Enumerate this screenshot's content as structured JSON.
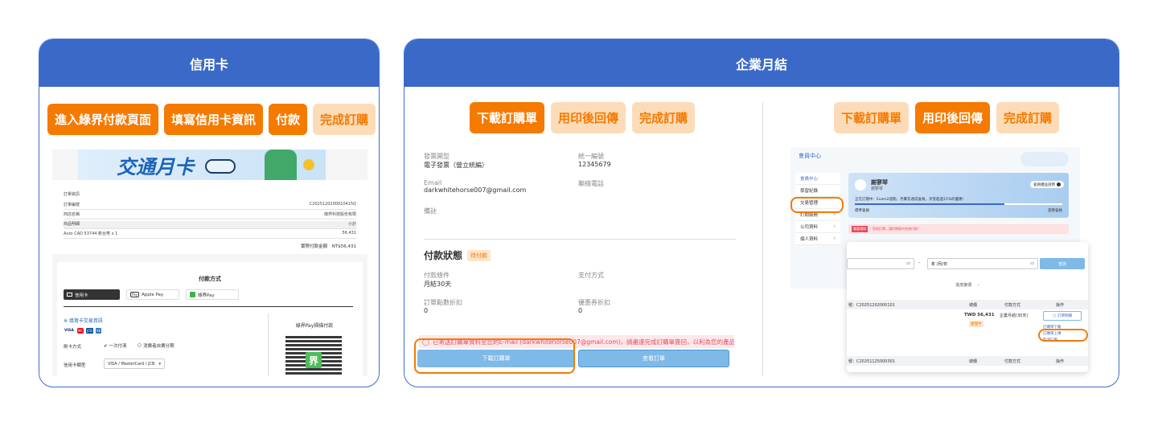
{
  "panels": {
    "credit": {
      "title": "信用卡",
      "steps": [
        "進入綠界付款頁面",
        "填寫信用卡資訊",
        "付款",
        "完成訂購"
      ],
      "screenshot": {
        "banner_text": "交通月卡",
        "order_rows": [
          {
            "label": "訂單資訊",
            "value": ""
          },
          {
            "label": "訂單編號",
            "value": "C2025120200010415Q"
          },
          {
            "label": "商店名稱",
            "value": "綠界科技股份有限"
          },
          {
            "label": "商品明細",
            "value": "小計"
          },
          {
            "label": "Auto CAD 53744 新台幣 x 1",
            "value": "56,431"
          }
        ],
        "total_label": "實際付款金額",
        "total_value": "NT$56,431",
        "payment_title": "付款方式",
        "methods": [
          "信用卡",
          "Apple Pay",
          "綠界Pay"
        ],
        "pay_logo_text": "Pay",
        "card_section_title": "※ 填寫卡交易資訊",
        "card_brands": [
          "VISA",
          "MC",
          "JCB",
          "AE"
        ],
        "installment_label": "刷卡方式",
        "installment_options": [
          "一次付清",
          "消費者自費分期"
        ],
        "card_type_label": "信用卡類型",
        "card_type_value": "VISA / MasterCard / JCB",
        "qr_title": "綠界Pay掃描付款",
        "qr_logo": "界"
      }
    },
    "enterprise": {
      "title": "企業月結",
      "left": {
        "steps": [
          "下載訂購單",
          "用印後回傳",
          "完成訂購"
        ],
        "fields": [
          {
            "label": "發票開型",
            "value": "電子發票（營立統編）"
          },
          {
            "label": "統一編號",
            "value": "12345679"
          },
          {
            "label": "Email",
            "value": "darkwhitehorse007@gmail.com"
          },
          {
            "label": "聯絡電話",
            "value": ""
          },
          {
            "label": "備註",
            "value": ""
          }
        ],
        "status_title": "付款狀態",
        "status_badge": "待付款",
        "pay_fields": [
          {
            "label": "付款條件",
            "value": "月結30天"
          },
          {
            "label": "支付方式",
            "value": ""
          },
          {
            "label": "訂單點數折扣",
            "value": "0"
          },
          {
            "label": "優惠券折扣",
            "value": "0"
          }
        ],
        "notice": "已寄送訂購單資料至您的E-mail (darkwhitehorse007@gmail.com)，請盡速完成訂購單簽回，以利為您的產品完成訂",
        "download_button": "下載訂購單",
        "view_button": "查看訂單"
      },
      "right": {
        "steps": [
          "下載訂購單",
          "用印後回傳",
          "完成訂購"
        ],
        "member_center": "會員中心",
        "menu": [
          "會員中心",
          "學習紀錄",
          "交易管理",
          "訂閱服務",
          "公司資料",
          "個人資料"
        ],
        "user_name": "謝寥琴",
        "user_sub": "謝寥琴",
        "member_button": "會員權益說明",
        "notice_bar": "正在訂閱中：Exam2週期，月費先達成會員，享受超過15%的優惠！",
        "level_label": "標準會員",
        "level_right": "進階會員",
        "alert_badge": "重要通知",
        "alert_text": "：您的訂單，請於期限內完成付款！",
        "date_placeholder": "年 /月/日",
        "date_sep": "-",
        "search_button": "查詢",
        "filter_label": "進度篩選",
        "order_no_1": "號：C20251202000101",
        "col_headers": [
          "總價",
          "付款方式",
          "操作"
        ],
        "amount": "TWD 56,431",
        "amount_badge": "處理中",
        "pay_method": "企業月結(30天)",
        "actions": [
          "訂單明細",
          "訂購單下載",
          "訂購單上傳",
          "取消訂單"
        ],
        "order_no_2": "號：C20251125000301"
      }
    }
  },
  "colors": {
    "header": "#3b69c7",
    "accent": "#f57a00",
    "accent_light": "#fcdcb8"
  }
}
